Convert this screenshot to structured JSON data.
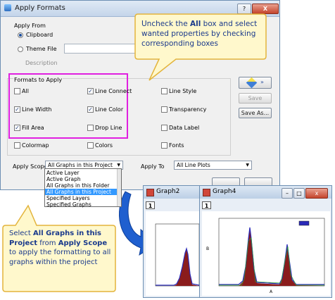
{
  "window": {
    "title": "Apply Formats",
    "help_btn": "?",
    "close_btn": "X"
  },
  "apply_from": {
    "group_label": "Apply From",
    "clipboard_label": "Clipboard",
    "theme_file_label": "Theme File",
    "description_label": "Description"
  },
  "formats": {
    "group_label": "Formats to Apply",
    "items": [
      {
        "label": "All",
        "checked": false
      },
      {
        "label": "Line Connect",
        "checked": true
      },
      {
        "label": "Line Style",
        "checked": false
      },
      {
        "label": "Line Width",
        "checked": true
      },
      {
        "label": "Line Color",
        "checked": true
      },
      {
        "label": "Transparency",
        "checked": false
      },
      {
        "label": "Fill Area",
        "checked": true
      },
      {
        "label": "Drop Line",
        "checked": false
      },
      {
        "label": "Data Label",
        "checked": false
      },
      {
        "label": "Colormap",
        "checked": false
      },
      {
        "label": "Colors",
        "checked": false
      },
      {
        "label": "Fonts",
        "checked": false
      }
    ]
  },
  "side_buttons": {
    "save": "Save",
    "save_as": "Save As..."
  },
  "apply_scope": {
    "label": "Apply Scope",
    "value": "All Graphs in this Project",
    "options": [
      "Active Layer",
      "Active Graph",
      "All Graphs in this Folder",
      "All Graphs in this Project",
      "Specified Layers",
      "Specified Graphs"
    ],
    "selected_index": 3
  },
  "apply_to": {
    "label": "Apply To",
    "value": "All Line Plots"
  },
  "callout_top": {
    "parts": [
      "Uncheck the ",
      "All",
      " box and select wanted properties by checking corresponding boxes"
    ]
  },
  "callout_bottom": {
    "parts": [
      "Select ",
      "All Graphs in this Project",
      " from ",
      "Apply Scope",
      " to apply the formatting to all graphs within the project"
    ]
  },
  "graphs": [
    {
      "title": "Graph2",
      "layer": "1"
    },
    {
      "title": "Graph4",
      "layer": "1",
      "x_label": "A",
      "y_label": "B"
    }
  ],
  "colors": {
    "accent": "#e020e0",
    "callout_fill": "#fff8cc",
    "callout_border": "#e3b43c",
    "arrow": "#1f5fcf",
    "series": "#2a2ab8",
    "fill": "#8a1c1c"
  }
}
